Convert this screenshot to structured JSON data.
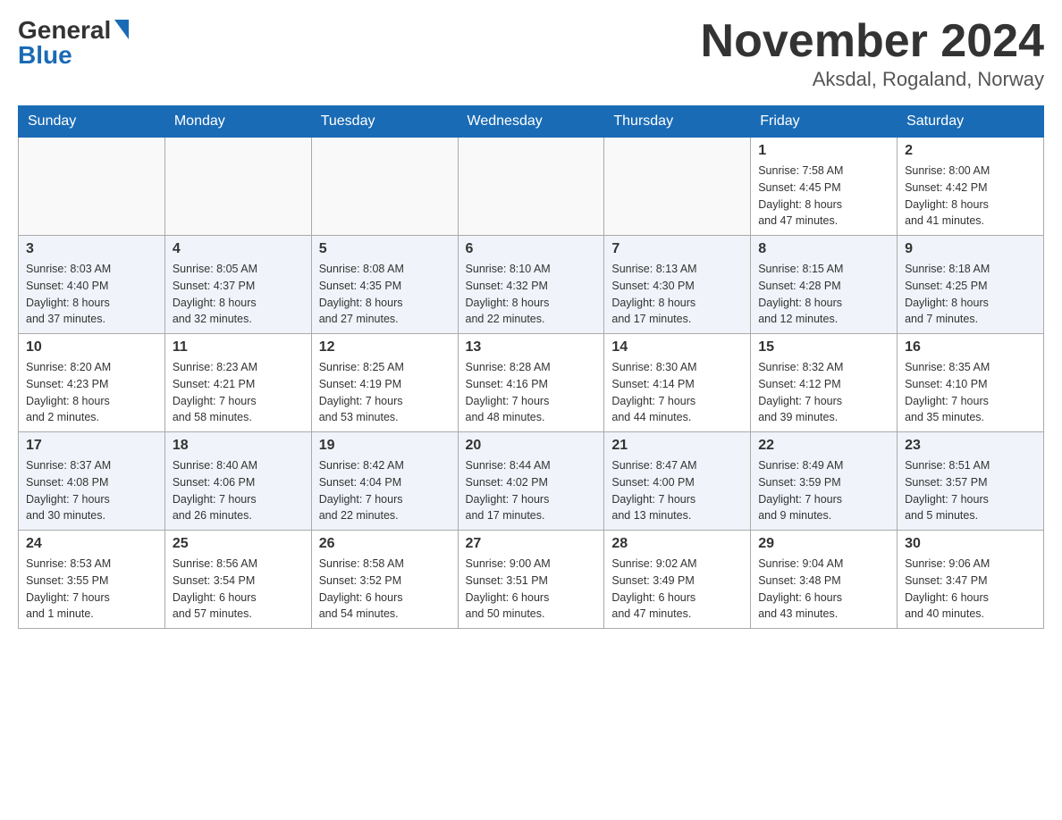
{
  "header": {
    "logo_general": "General",
    "logo_blue": "Blue",
    "month_title": "November 2024",
    "location": "Aksdal, Rogaland, Norway"
  },
  "days_of_week": [
    "Sunday",
    "Monday",
    "Tuesday",
    "Wednesday",
    "Thursday",
    "Friday",
    "Saturday"
  ],
  "weeks": [
    [
      {
        "day": "",
        "info": ""
      },
      {
        "day": "",
        "info": ""
      },
      {
        "day": "",
        "info": ""
      },
      {
        "day": "",
        "info": ""
      },
      {
        "day": "",
        "info": ""
      },
      {
        "day": "1",
        "info": "Sunrise: 7:58 AM\nSunset: 4:45 PM\nDaylight: 8 hours\nand 47 minutes."
      },
      {
        "day": "2",
        "info": "Sunrise: 8:00 AM\nSunset: 4:42 PM\nDaylight: 8 hours\nand 41 minutes."
      }
    ],
    [
      {
        "day": "3",
        "info": "Sunrise: 8:03 AM\nSunset: 4:40 PM\nDaylight: 8 hours\nand 37 minutes."
      },
      {
        "day": "4",
        "info": "Sunrise: 8:05 AM\nSunset: 4:37 PM\nDaylight: 8 hours\nand 32 minutes."
      },
      {
        "day": "5",
        "info": "Sunrise: 8:08 AM\nSunset: 4:35 PM\nDaylight: 8 hours\nand 27 minutes."
      },
      {
        "day": "6",
        "info": "Sunrise: 8:10 AM\nSunset: 4:32 PM\nDaylight: 8 hours\nand 22 minutes."
      },
      {
        "day": "7",
        "info": "Sunrise: 8:13 AM\nSunset: 4:30 PM\nDaylight: 8 hours\nand 17 minutes."
      },
      {
        "day": "8",
        "info": "Sunrise: 8:15 AM\nSunset: 4:28 PM\nDaylight: 8 hours\nand 12 minutes."
      },
      {
        "day": "9",
        "info": "Sunrise: 8:18 AM\nSunset: 4:25 PM\nDaylight: 8 hours\nand 7 minutes."
      }
    ],
    [
      {
        "day": "10",
        "info": "Sunrise: 8:20 AM\nSunset: 4:23 PM\nDaylight: 8 hours\nand 2 minutes."
      },
      {
        "day": "11",
        "info": "Sunrise: 8:23 AM\nSunset: 4:21 PM\nDaylight: 7 hours\nand 58 minutes."
      },
      {
        "day": "12",
        "info": "Sunrise: 8:25 AM\nSunset: 4:19 PM\nDaylight: 7 hours\nand 53 minutes."
      },
      {
        "day": "13",
        "info": "Sunrise: 8:28 AM\nSunset: 4:16 PM\nDaylight: 7 hours\nand 48 minutes."
      },
      {
        "day": "14",
        "info": "Sunrise: 8:30 AM\nSunset: 4:14 PM\nDaylight: 7 hours\nand 44 minutes."
      },
      {
        "day": "15",
        "info": "Sunrise: 8:32 AM\nSunset: 4:12 PM\nDaylight: 7 hours\nand 39 minutes."
      },
      {
        "day": "16",
        "info": "Sunrise: 8:35 AM\nSunset: 4:10 PM\nDaylight: 7 hours\nand 35 minutes."
      }
    ],
    [
      {
        "day": "17",
        "info": "Sunrise: 8:37 AM\nSunset: 4:08 PM\nDaylight: 7 hours\nand 30 minutes."
      },
      {
        "day": "18",
        "info": "Sunrise: 8:40 AM\nSunset: 4:06 PM\nDaylight: 7 hours\nand 26 minutes."
      },
      {
        "day": "19",
        "info": "Sunrise: 8:42 AM\nSunset: 4:04 PM\nDaylight: 7 hours\nand 22 minutes."
      },
      {
        "day": "20",
        "info": "Sunrise: 8:44 AM\nSunset: 4:02 PM\nDaylight: 7 hours\nand 17 minutes."
      },
      {
        "day": "21",
        "info": "Sunrise: 8:47 AM\nSunset: 4:00 PM\nDaylight: 7 hours\nand 13 minutes."
      },
      {
        "day": "22",
        "info": "Sunrise: 8:49 AM\nSunset: 3:59 PM\nDaylight: 7 hours\nand 9 minutes."
      },
      {
        "day": "23",
        "info": "Sunrise: 8:51 AM\nSunset: 3:57 PM\nDaylight: 7 hours\nand 5 minutes."
      }
    ],
    [
      {
        "day": "24",
        "info": "Sunrise: 8:53 AM\nSunset: 3:55 PM\nDaylight: 7 hours\nand 1 minute."
      },
      {
        "day": "25",
        "info": "Sunrise: 8:56 AM\nSunset: 3:54 PM\nDaylight: 6 hours\nand 57 minutes."
      },
      {
        "day": "26",
        "info": "Sunrise: 8:58 AM\nSunset: 3:52 PM\nDaylight: 6 hours\nand 54 minutes."
      },
      {
        "day": "27",
        "info": "Sunrise: 9:00 AM\nSunset: 3:51 PM\nDaylight: 6 hours\nand 50 minutes."
      },
      {
        "day": "28",
        "info": "Sunrise: 9:02 AM\nSunset: 3:49 PM\nDaylight: 6 hours\nand 47 minutes."
      },
      {
        "day": "29",
        "info": "Sunrise: 9:04 AM\nSunset: 3:48 PM\nDaylight: 6 hours\nand 43 minutes."
      },
      {
        "day": "30",
        "info": "Sunrise: 9:06 AM\nSunset: 3:47 PM\nDaylight: 6 hours\nand 40 minutes."
      }
    ]
  ]
}
